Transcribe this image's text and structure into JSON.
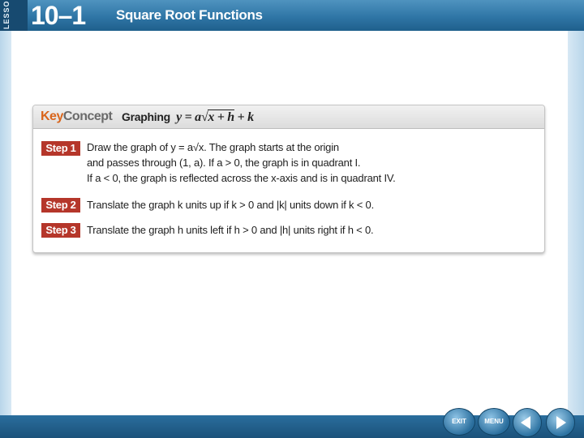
{
  "header": {
    "lesson_word": "LESSON",
    "lesson_number": "10–1",
    "title": "Square Root Functions"
  },
  "key_concept": {
    "label_key": "Key",
    "label_concept": "Concept",
    "heading_text": "Graphing",
    "steps": [
      {
        "badge": "Step 1",
        "lines": [
          "Draw the graph of y = a√x. The graph starts at the origin",
          "and passes through (1, a). If a > 0, the graph is in quadrant I.",
          "If a < 0, the graph is reflected across the x-axis and is in quadrant IV."
        ]
      },
      {
        "badge": "Step 2",
        "lines": [
          "Translate the graph k units up if k > 0 and |k| units down if k < 0."
        ]
      },
      {
        "badge": "Step 3",
        "lines": [
          "Translate the graph h units left if h > 0 and |h| units right if h < 0."
        ]
      }
    ]
  },
  "nav": {
    "exit_label": "EXIT",
    "menu_label": "MENU"
  },
  "colors": {
    "header_blue": "#2f76a6",
    "key_orange": "#d9651b",
    "step_red": "#b5362a"
  }
}
